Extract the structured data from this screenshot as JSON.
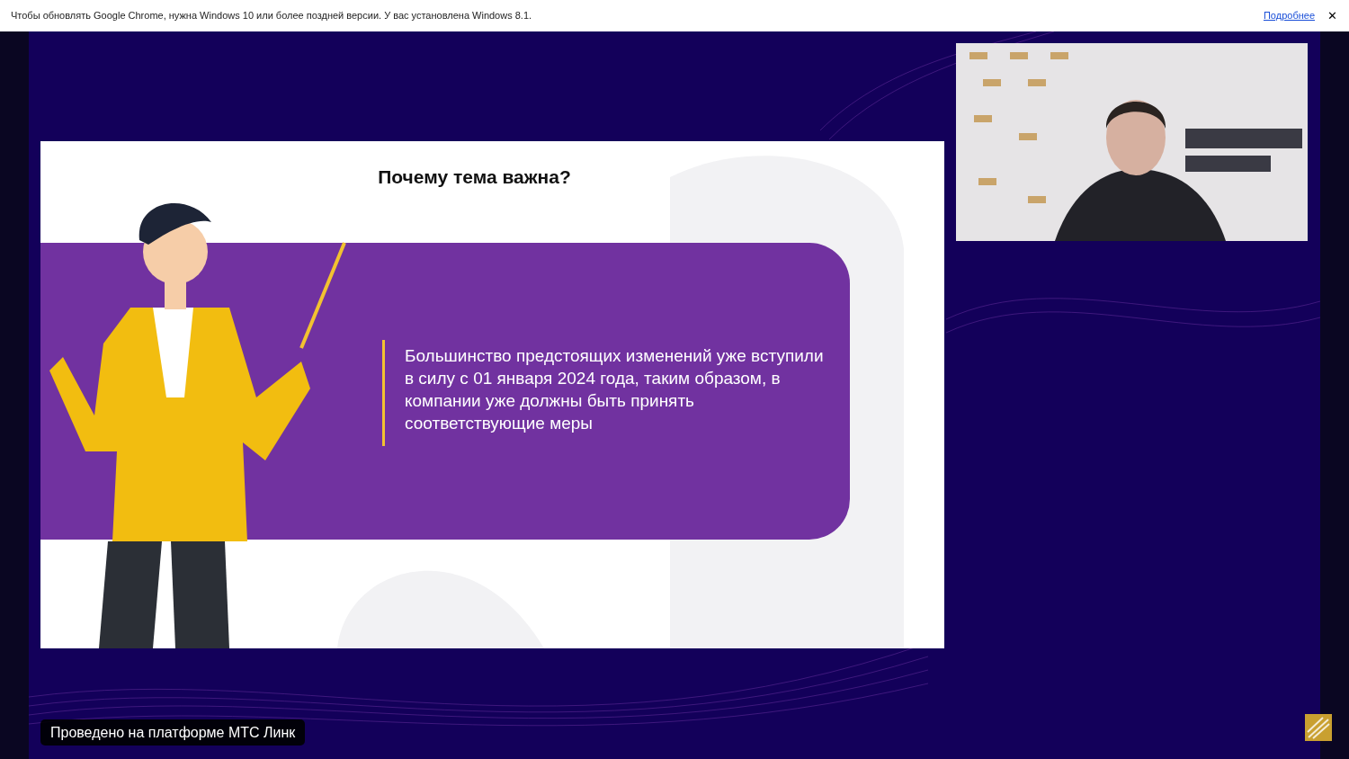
{
  "notice_bar": {
    "message": "Чтобы обновлять Google Chrome, нужна Windows 10 или более поздней версии. У вас установлена Windows 8.1.",
    "link": "Подробнее",
    "close": "✕"
  },
  "slide": {
    "title": "Почему тема важна?",
    "body": "Большинство предстоящих изменений уже вступили в силу с 01 января 2024 года, таким образом, в компании уже должны быть принять соответствующие меры"
  },
  "platform_badge": "Проведено на платформе МТС Линк"
}
